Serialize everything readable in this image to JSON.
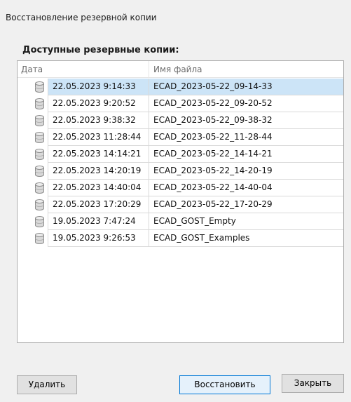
{
  "dialog": {
    "title": "Восстановление резервной копии"
  },
  "section_label": "Доступные резервные копии:",
  "table": {
    "columns": {
      "date": "Дата",
      "file": "Имя файла"
    },
    "rows": [
      {
        "date": "22.05.2023 9:14:33",
        "file": "ECAD_2023-05-22_09-14-33",
        "selected": true
      },
      {
        "date": "22.05.2023 9:20:52",
        "file": "ECAD_2023-05-22_09-20-52"
      },
      {
        "date": "22.05.2023 9:38:32",
        "file": "ECAD_2023-05-22_09-38-32"
      },
      {
        "date": "22.05.2023 11:28:44",
        "file": "ECAD_2023-05-22_11-28-44"
      },
      {
        "date": "22.05.2023 14:14:21",
        "file": "ECAD_2023-05-22_14-14-21"
      },
      {
        "date": "22.05.2023 14:20:19",
        "file": "ECAD_2023-05-22_14-20-19"
      },
      {
        "date": "22.05.2023 14:40:04",
        "file": "ECAD_2023-05-22_14-40-04"
      },
      {
        "date": "22.05.2023 17:20:29",
        "file": "ECAD_2023-05-22_17-20-29"
      },
      {
        "date": "19.05.2023 7:47:24",
        "file": "ECAD_GOST_Empty"
      },
      {
        "date": "19.05.2023 9:26:53",
        "file": "ECAD_GOST_Examples"
      }
    ],
    "row_icon": "database-icon",
    "selected_color": "#cce4f7"
  },
  "buttons": {
    "delete": "Удалить",
    "restore": "Восстановить",
    "close": "Закрыть"
  }
}
